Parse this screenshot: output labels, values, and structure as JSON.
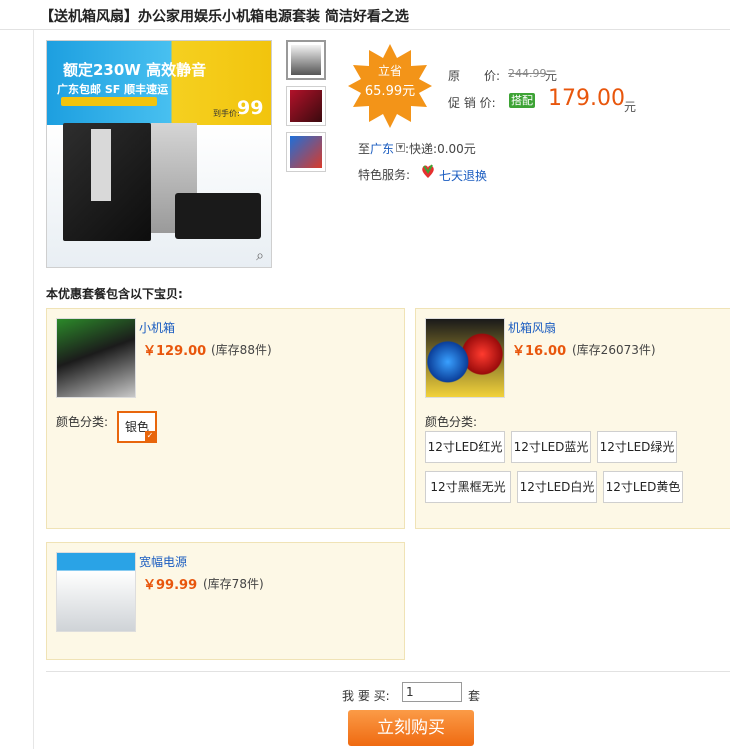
{
  "product": {
    "title": "【送机箱风扇】办公家用娱乐小机箱电源套装 简洁好看之选"
  },
  "gallery": {
    "ad_headline": "额定230W 高效静音",
    "ad_sub": "广东包邮 SF 顺丰速运",
    "ad_price_label": "到手价:",
    "ad_price": "99",
    "thumbnail_count": 3
  },
  "pricing": {
    "burst_label": "立省",
    "burst_value": "65.99元",
    "original_label": "原　　价:",
    "original_value": "244.99",
    "original_unit": "元",
    "promo_label": "促 销 价:",
    "promo_tag": "搭配",
    "promo_value": "179.00",
    "promo_unit": "元"
  },
  "shipping": {
    "to_label": "至",
    "destination": "广东",
    "method": ":快递:0.00元"
  },
  "service": {
    "label": "特色服务:",
    "link": "七天退换"
  },
  "package": {
    "heading": "本优惠套餐包含以下宝贝:",
    "items": [
      {
        "name": "小机箱",
        "price": "￥129.00",
        "stock": "(库存88件)",
        "color_label": "颜色分类:",
        "options": [
          "银色"
        ],
        "selected": 0
      },
      {
        "name": "机箱风扇",
        "price": "￥16.00",
        "stock": "(库存26073件)",
        "color_label": "颜色分类:",
        "options": [
          "12寸LED红光",
          "12寸LED蓝光",
          "12寸LED绿光",
          "12寸黑框无光",
          "12寸LED白光",
          "12寸LED黄色"
        ]
      },
      {
        "name": "宽幅电源",
        "price": "￥99.99",
        "stock": "(库存78件)"
      }
    ]
  },
  "purchase": {
    "qty_label": "我 要 买:",
    "qty_value": "1",
    "qty_unit": "套",
    "buy_button": "立刻购买"
  },
  "colors": {
    "price_orange": "#e8560c",
    "link_blue": "#1a5cc0",
    "card_bg": "#fdf8e6",
    "tag_green": "#3da335"
  }
}
